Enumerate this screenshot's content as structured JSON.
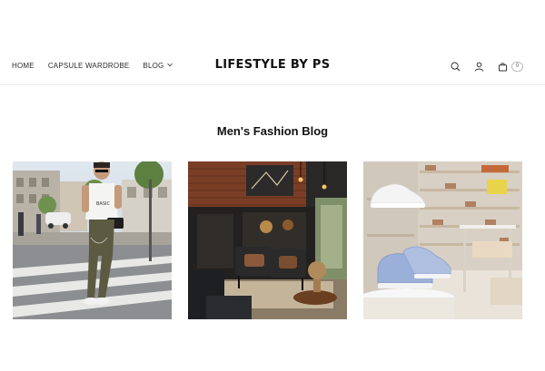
{
  "header": {
    "nav": [
      {
        "label": "HOME"
      },
      {
        "label": "CAPSULE WARDROBE"
      },
      {
        "label": "BLOG",
        "has_dropdown": true
      }
    ],
    "logo": "LIFESTYLE BY PS",
    "cart_count": "0"
  },
  "main": {
    "title": "Men's Fashion Blog",
    "cards": [
      {
        "image": "man-walking-street-photo"
      },
      {
        "image": "dark-lounge-interior-photo"
      },
      {
        "image": "sneaker-store-display-photo"
      }
    ]
  }
}
